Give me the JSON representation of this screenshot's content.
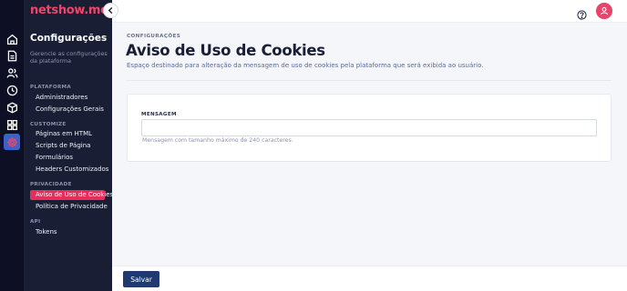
{
  "brand": {
    "name": "netshow.me",
    "color": "#f0456a"
  },
  "rail": {
    "icons": [
      "home-icon",
      "document-icon",
      "users-icon",
      "clock-icon",
      "cube-icon",
      "grid-icon",
      "gear-icon"
    ],
    "active": "gear-icon"
  },
  "sidebar": {
    "title": "Configurações",
    "subtitle": "Gerencie as configurações da plataforma",
    "sections": [
      {
        "label": "PLATAFORMA",
        "items": [
          "Administradores",
          "Configurações Gerais"
        ]
      },
      {
        "label": "CUSTOMIZE",
        "items": [
          "Páginas em HTML",
          "Scripts de Página",
          "Formulários",
          "Headers Customizados"
        ]
      },
      {
        "label": "PRIVACIDADE",
        "items": [
          "Aviso de Uso de Cookies",
          "Política de Privacidade"
        ]
      },
      {
        "label": "API",
        "items": [
          "Tokens"
        ]
      }
    ],
    "active_item": "Aviso de Uso de Cookies",
    "accent": "#e52e5e"
  },
  "main": {
    "breadcrumb": "CONFIGURAÇÕES",
    "title": "Aviso de Uso de Cookies",
    "description": "Espaço destinado para alteração da mensagem de uso de cookies pela plataforma que será exibida ao usuário.",
    "field": {
      "label": "MENSAGEM",
      "value": "",
      "help": "Mensagem com tamanho máximo de 240 caracteres."
    }
  },
  "footer": {
    "save_label": "Salvar"
  }
}
